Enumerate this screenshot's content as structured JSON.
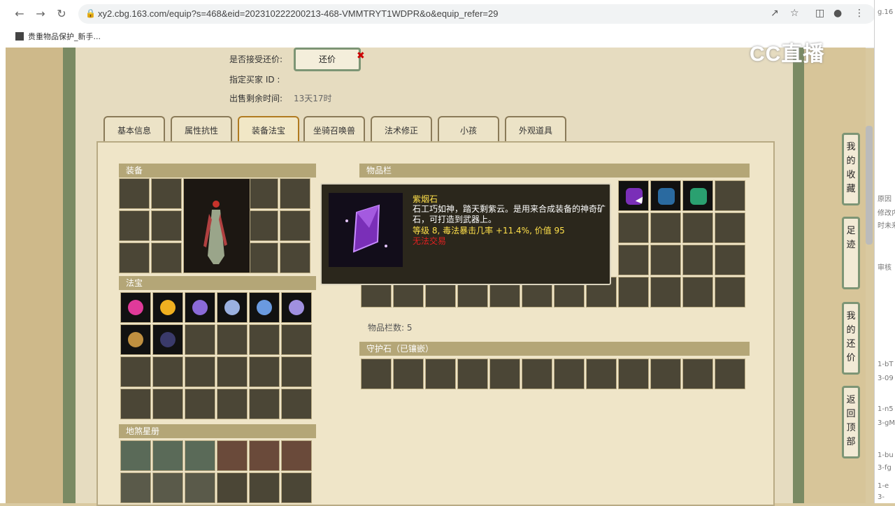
{
  "browser": {
    "url": "xy2.cbg.163.com/equip?s=468&eid=202310222200213-468-VMMTRYT1WDPR&o&equip_refer=29",
    "bookmark": "贵重物品保护_新手...",
    "right_edge_text": "g.16"
  },
  "watermark": "CC直播",
  "info": {
    "accept_offer_label": "是否接受还价:",
    "offer_button": "还价",
    "buyer_id_label": "指定买家 ID :",
    "time_left_label": "出售剩余时间:",
    "time_left_value": "13天17时"
  },
  "tabs": [
    "基本信息",
    "属性抗性",
    "装备法宝",
    "坐骑召唤兽",
    "法术修正",
    "小孩",
    "外观道具"
  ],
  "sections": {
    "equipment": "装备",
    "treasure": "法宝",
    "star_book": "地煞星册",
    "inventory": "物品栏",
    "inventory_count": "物品栏数: 5",
    "guard_stone": "守护石（已镶嵌）"
  },
  "tooltip": {
    "name": "紫烟石",
    "desc": "石工巧如神，踏天剩紫云。是用来合成装备的神奇矿石，可打造到武器上。",
    "stats": "等级 8, 毒法暴击几率 +11.4%, 价值 95",
    "trade": "无法交易"
  },
  "side_buttons": [
    [
      "我",
      "的",
      "收",
      "藏"
    ],
    [
      "足",
      "迹"
    ],
    [
      "我",
      "的",
      "还",
      "价"
    ],
    [
      "返",
      "回",
      "顶",
      "部"
    ]
  ],
  "right_strip_text": [
    "原因",
    "修改内",
    "时未来",
    "审核",
    "1-bT",
    "3-09",
    "1-n5",
    "3-gM",
    "1-bu",
    "3-fg",
    "1-e",
    "3-"
  ],
  "colors": {
    "section_header": "#b4a677",
    "frame_green": "#7d9575",
    "tooltip_name": "#ffe04a",
    "tooltip_trade": "#e02020"
  }
}
